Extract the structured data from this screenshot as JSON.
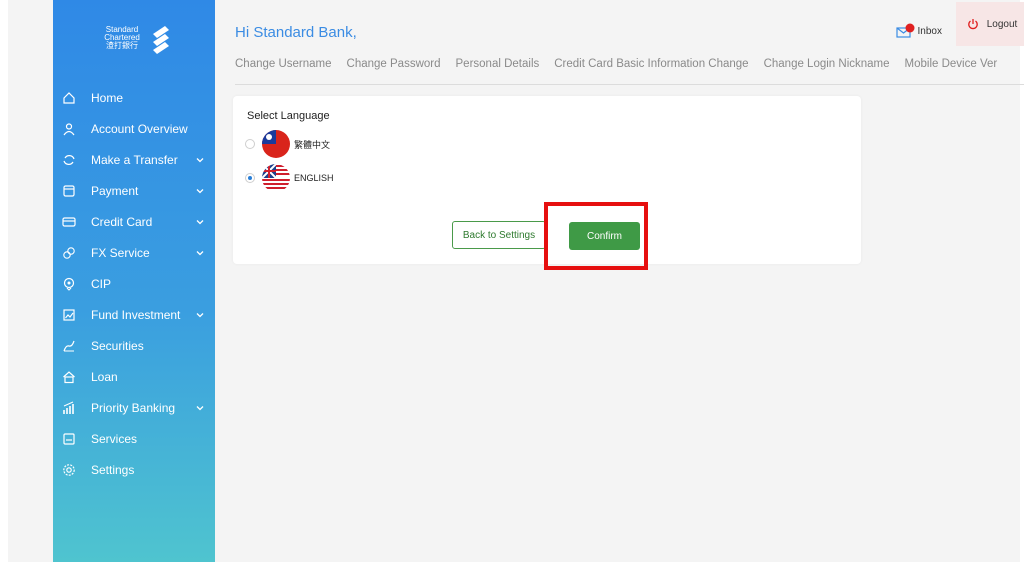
{
  "logo": {
    "line1": "Standard",
    "line2": "Chartered",
    "line3": "渣打銀行"
  },
  "sidebar": {
    "items": [
      {
        "label": "Home",
        "icon": "home-icon",
        "has_submenu": false
      },
      {
        "label": "Account Overview",
        "icon": "user-icon",
        "has_submenu": false
      },
      {
        "label": "Make a Transfer",
        "icon": "transfer-icon",
        "has_submenu": true
      },
      {
        "label": "Payment",
        "icon": "payment-icon",
        "has_submenu": true
      },
      {
        "label": "Credit Card",
        "icon": "credit-card-icon",
        "has_submenu": true
      },
      {
        "label": "FX Service",
        "icon": "fx-icon",
        "has_submenu": true
      },
      {
        "label": "CIP",
        "icon": "cip-icon",
        "has_submenu": false
      },
      {
        "label": "Fund Investment",
        "icon": "chart-icon",
        "has_submenu": true
      },
      {
        "label": "Securities",
        "icon": "securities-icon",
        "has_submenu": false
      },
      {
        "label": "Loan",
        "icon": "loan-icon",
        "has_submenu": false
      },
      {
        "label": "Priority Banking",
        "icon": "bar-chart-icon",
        "has_submenu": true
      },
      {
        "label": "Services",
        "icon": "services-icon",
        "has_submenu": false
      },
      {
        "label": "Settings",
        "icon": "gear-icon",
        "has_submenu": false
      }
    ]
  },
  "header": {
    "greeting": "Hi Standard Bank,",
    "inbox_label": "Inbox",
    "logout_label": "Logout"
  },
  "tabs": [
    "Change Username",
    "Change Password",
    "Personal Details",
    "Credit Card Basic Information Change",
    "Change Login Nickname",
    "Mobile Device Ver"
  ],
  "language_card": {
    "title": "Select Language",
    "options": [
      {
        "label": "繁體中文",
        "selected": false,
        "flag": "taiwan-flag-icon"
      },
      {
        "label": "ENGLISH",
        "selected": true,
        "flag": "us-uk-flag-icon"
      }
    ],
    "back_label": "Back to Settings",
    "confirm_label": "Confirm"
  },
  "colors": {
    "accent_blue": "#3b8ce3",
    "confirm_green": "#3f9a46",
    "highlight_red": "#e60f0f"
  }
}
